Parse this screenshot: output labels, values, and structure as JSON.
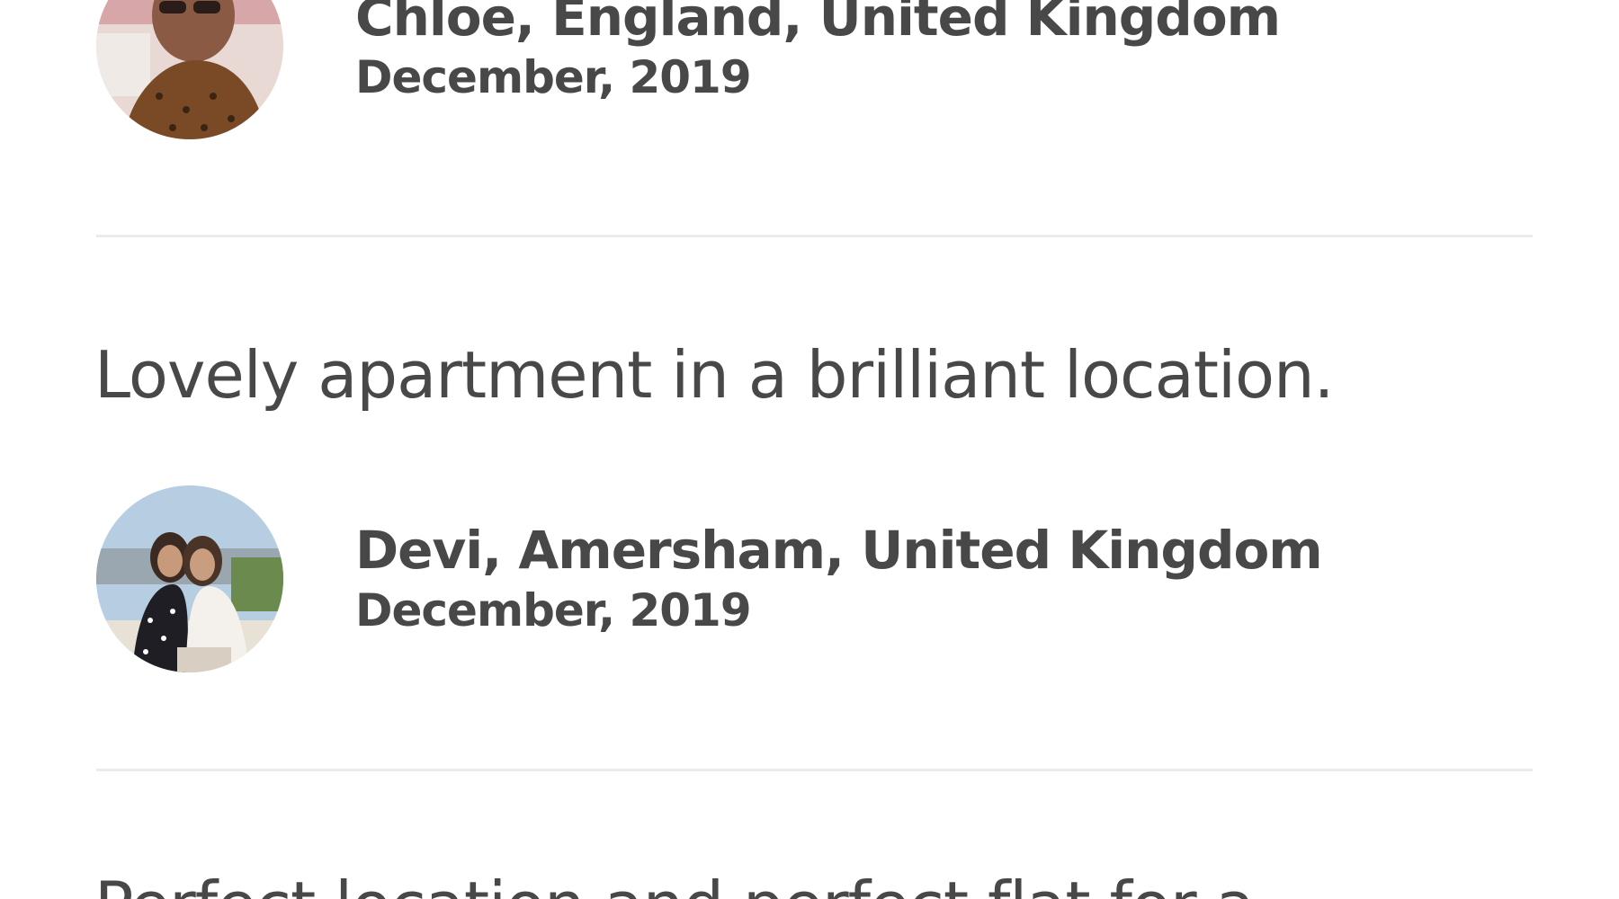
{
  "reviews": [
    {
      "author": "Chloe, England, United Kingdom",
      "date": "December, 2019",
      "avatar_icon": "avatar-photo-chloe"
    },
    {
      "text": "Lovely apartment in a brilliant location.",
      "author": "Devi, Amersham, United Kingdom",
      "date": "December, 2019",
      "avatar_icon": "avatar-photo-devi"
    },
    {
      "text": "Perfect location and perfect flat for a"
    }
  ],
  "colors": {
    "text": "#484848",
    "divider": "#ebebeb",
    "background": "#ffffff"
  }
}
